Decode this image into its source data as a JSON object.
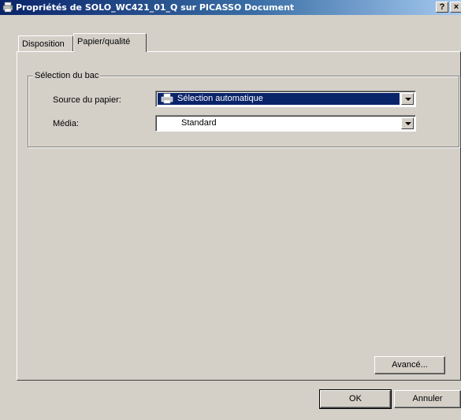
{
  "window": {
    "title": "Propriétés de SOLO_WC421_01_Q sur PICASSO Document",
    "help_label": "?",
    "close_label": "×"
  },
  "tabs": [
    {
      "label": "Disposition",
      "active": false
    },
    {
      "label": "Papier/qualité",
      "active": true
    }
  ],
  "groupbox": {
    "legend": "Sélection du bac",
    "source": {
      "label": "Source du papier:",
      "value": "Sélection automatique",
      "icon": "printer-icon"
    },
    "media": {
      "label": "Média:",
      "value": "Standard"
    }
  },
  "buttons": {
    "advanced": "Avancé...",
    "ok": "OK",
    "cancel": "Annuler"
  },
  "colors": {
    "titlebar_start": "#0a246a",
    "titlebar_end": "#a6caf0",
    "face": "#d4d0c8",
    "selection": "#0a246a"
  }
}
